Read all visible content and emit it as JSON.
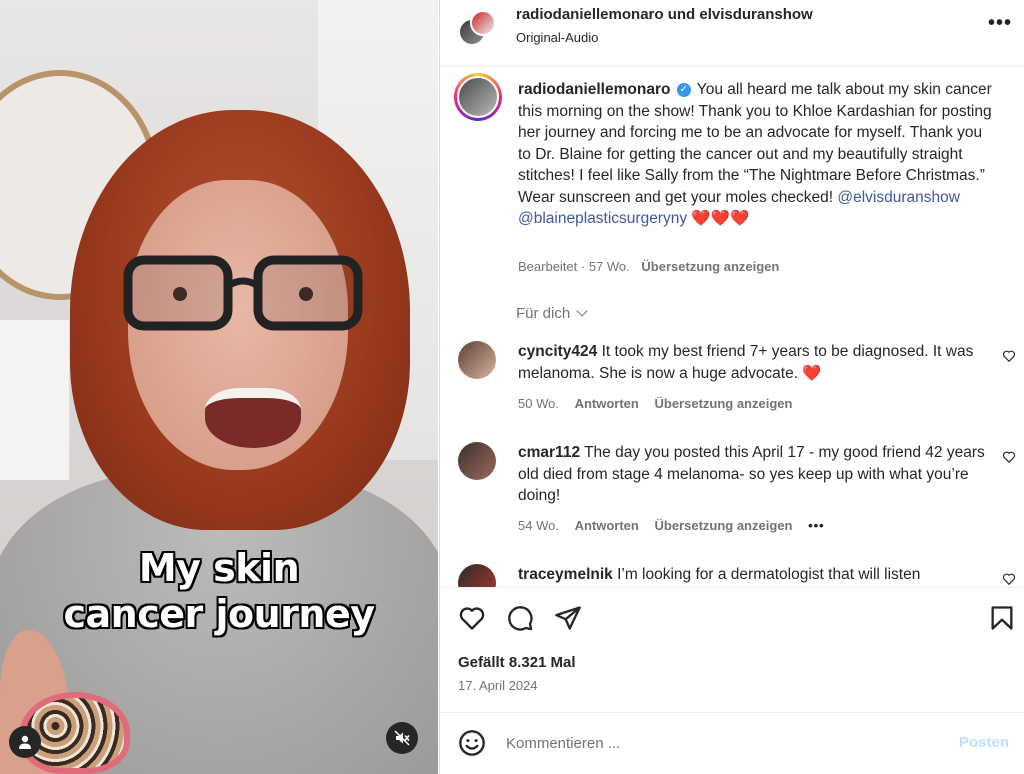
{
  "video": {
    "caption_line1": "My skin",
    "caption_line2": "cancer journey"
  },
  "header": {
    "names": "radiodaniellemonaro und elvisduranshow",
    "audio": "Original-Audio",
    "more": "•••"
  },
  "post": {
    "username": "radiodaniellemonaro",
    "text_part1": " You all heard me talk about my skin cancer this morning on the show! Thank you to Khloe Kardashian for posting her journey and forcing me to be an advocate for myself. Thank you to Dr. Blaine for getting the cancer out and my beautifully straight stitches! I feel like Sally from the “The Nightmare Before Christmas.” Wear sunscreen and get your moles checked! ",
    "mention1": "@elvisduranshow",
    "mention2": "@blaineplasticsurgeryny",
    "hearts": " ❤️❤️❤️",
    "meta_edited": "Bearbeitet · 57 Wo.",
    "meta_translate": "Übersetzung anzeigen"
  },
  "filter": {
    "label": "Für dich"
  },
  "comments": [
    {
      "username": "cyncity424",
      "text": " It took my best friend 7+ years to be diagnosed. It was melanoma. She is now a huge advocate. ❤️",
      "age": "50 Wo.",
      "reply": "Antworten",
      "translate": "Übersetzung anzeigen"
    },
    {
      "username": "cmar112",
      "text": " The day you posted this April 17 - my good friend 42 years old died from stage 4 melanoma- so yes keep up with what you’re doing!",
      "age": "54 Wo.",
      "reply": "Antworten",
      "translate": "Übersetzung anzeigen",
      "more": "•••"
    },
    {
      "username": "traceymelnik",
      "text": " I’m looking for a dermatologist that will listen"
    }
  ],
  "footer": {
    "likes": "Gefällt 8.321 Mal",
    "date": "17. April 2024",
    "comment_placeholder": "Kommentieren ...",
    "post_label": "Posten"
  },
  "colors": {
    "mention": "#4056a1",
    "post_disabled": "#c0dffd",
    "muted_text": "#737373"
  },
  "icons": [
    "profile-icon",
    "mute-icon",
    "more-icon",
    "verified-icon",
    "chevron-down-icon",
    "heart-icon",
    "comment-icon",
    "share-icon",
    "bookmark-icon",
    "emoji-icon"
  ]
}
